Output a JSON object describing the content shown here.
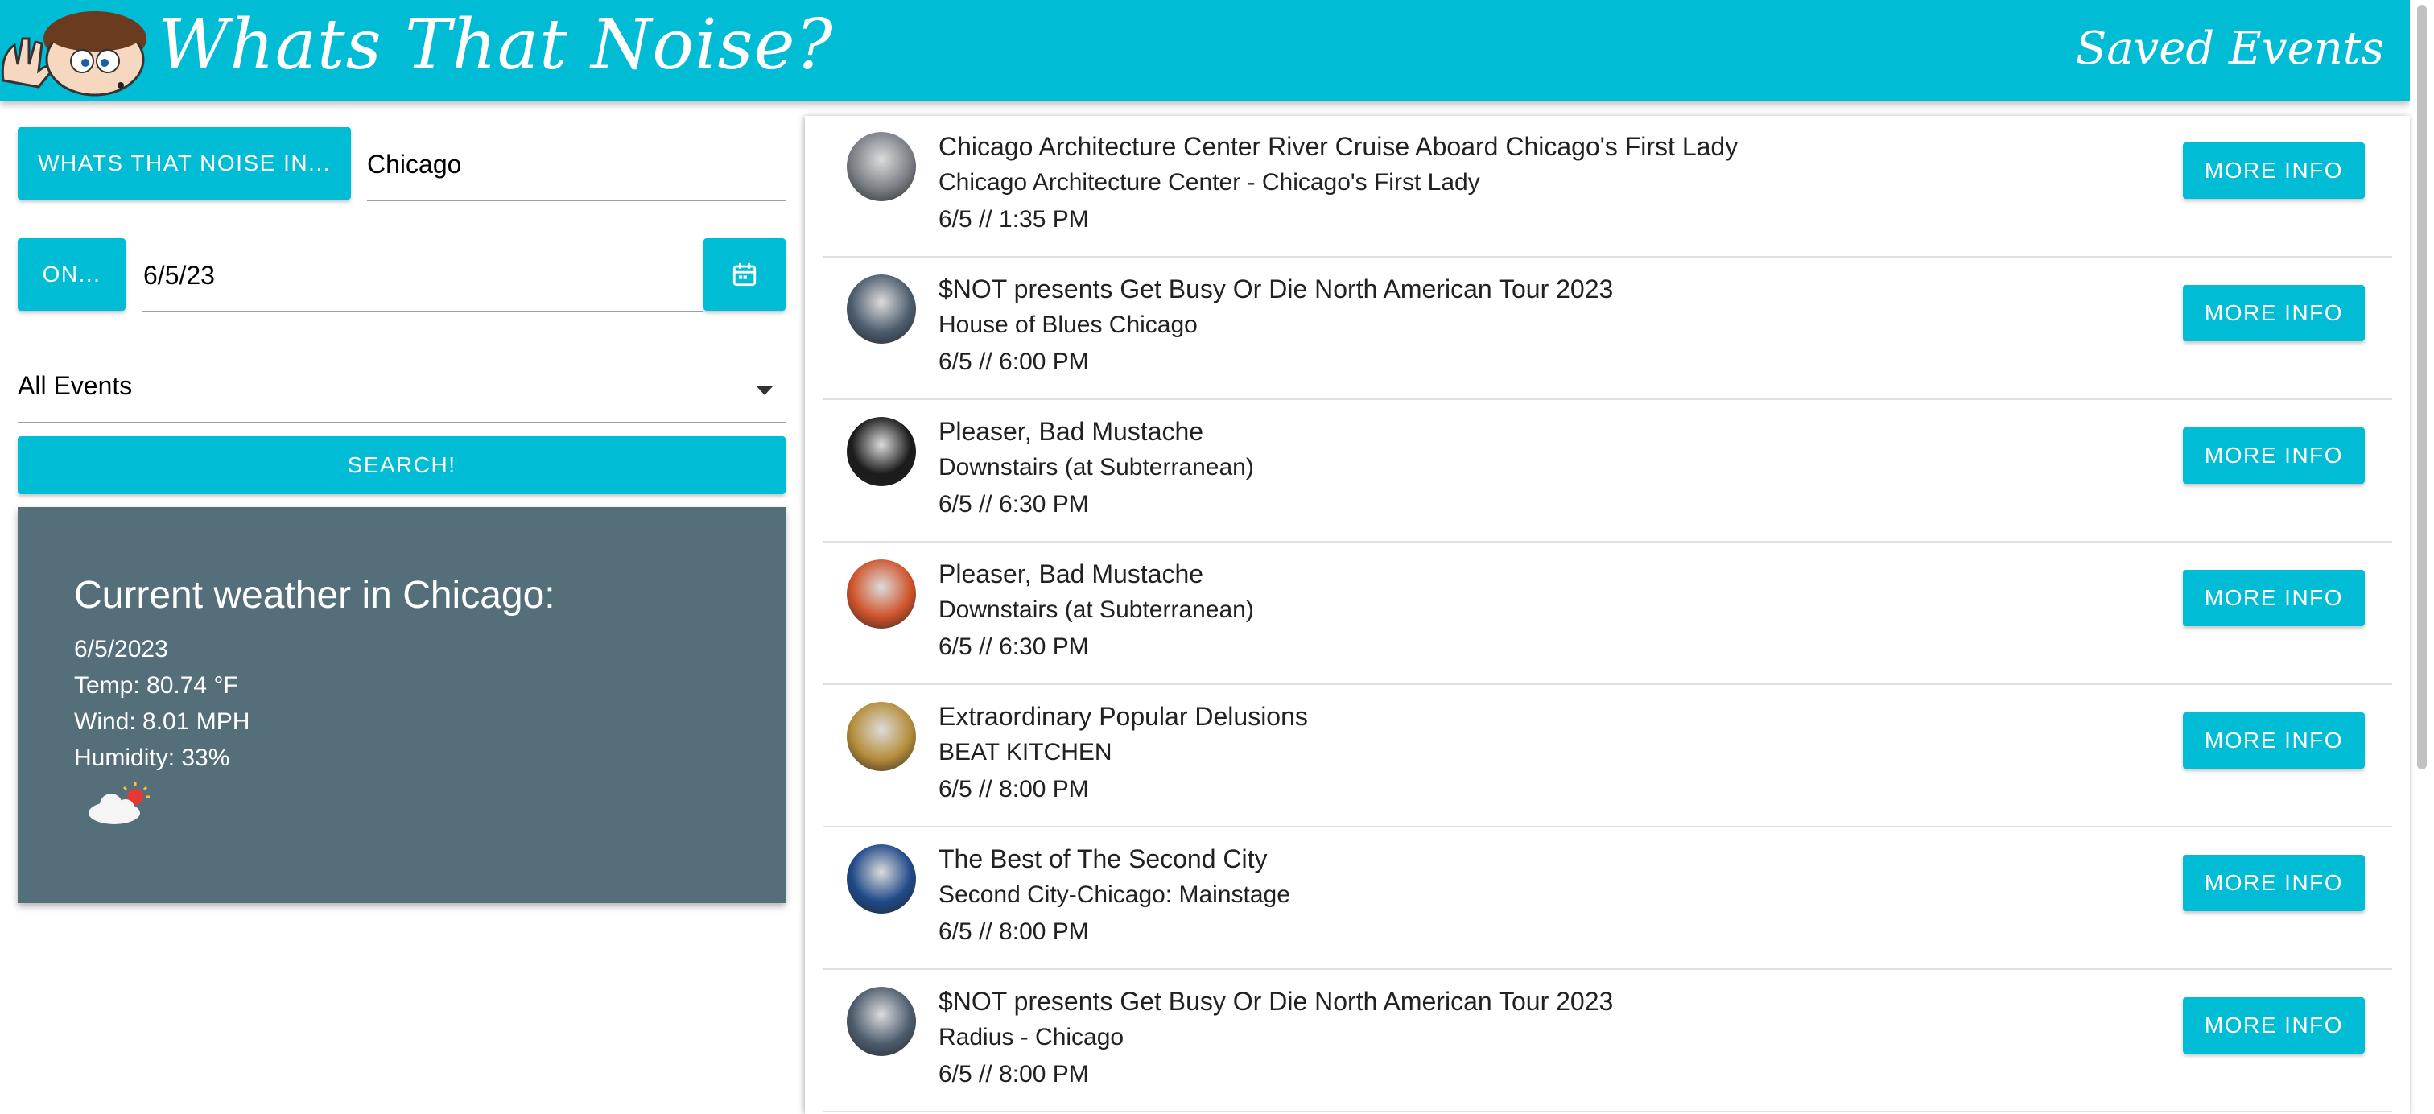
{
  "header": {
    "app_title": "Whats That Noise?",
    "saved_events_label": "Saved Events",
    "logo_icon": "cartoon-face-waving-icon",
    "accent_color": "#00bcd4"
  },
  "search_form": {
    "location_button_label": "WHATS THAT NOISE IN...",
    "location_value": "Chicago",
    "date_button_label": "ON...",
    "date_value": "6/5/23",
    "calendar_icon": "calendar-icon",
    "category_value": "All Events",
    "search_button_label": "SEARCH!"
  },
  "weather": {
    "title": "Current weather in Chicago:",
    "date": "6/5/2023",
    "temp": "Temp: 80.74 °F",
    "wind": "Wind: 8.01 MPH",
    "humidity": "Humidity: 33%",
    "icon": "partly-cloudy-icon",
    "card_color": "#546e7a"
  },
  "events": [
    {
      "title": "Chicago Architecture Center River Cruise Aboard Chicago's First Lady",
      "venue": "Chicago Architecture Center - Chicago's First Lady",
      "time": "6/5 // 1:35 PM",
      "button": "MORE INFO",
      "avatar_color": "#7a7f86"
    },
    {
      "title": "$NOT presents Get Busy Or Die North American Tour 2023",
      "venue": "House of Blues Chicago",
      "time": "6/5 // 6:00 PM",
      "button": "MORE INFO",
      "avatar_color": "#4d5d6e"
    },
    {
      "title": "Pleaser, Bad Mustache",
      "venue": "Downstairs (at Subterranean)",
      "time": "6/5 // 6:30 PM",
      "button": "MORE INFO",
      "avatar_color": "#1b1b1b"
    },
    {
      "title": "Pleaser, Bad Mustache",
      "venue": "Downstairs (at Subterranean)",
      "time": "6/5 // 6:30 PM",
      "button": "MORE INFO",
      "avatar_color": "#d0532a"
    },
    {
      "title": "Extraordinary Popular Delusions",
      "venue": "BEAT KITCHEN",
      "time": "6/5 // 8:00 PM",
      "button": "MORE INFO",
      "avatar_color": "#b58d3a"
    },
    {
      "title": "The Best of The Second City",
      "venue": "Second City-Chicago: Mainstage",
      "time": "6/5 // 8:00 PM",
      "button": "MORE INFO",
      "avatar_color": "#1f4a8a"
    },
    {
      "title": "$NOT presents Get Busy Or Die North American Tour 2023",
      "venue": "Radius - Chicago",
      "time": "6/5 // 8:00 PM",
      "button": "MORE INFO",
      "avatar_color": "#4d5d6e"
    }
  ]
}
